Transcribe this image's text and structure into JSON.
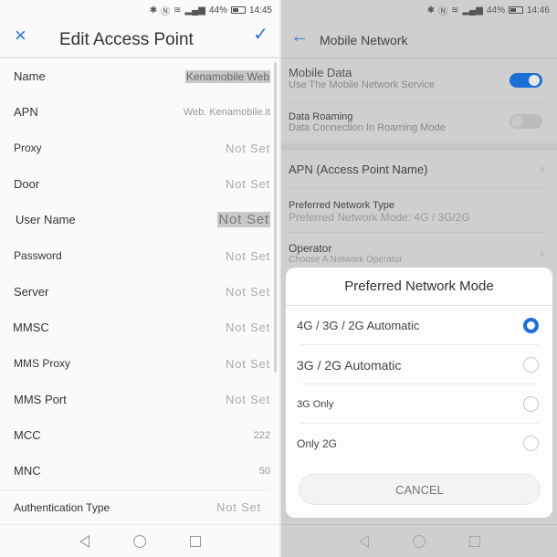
{
  "left": {
    "status": {
      "icons": [
        "bluetooth-icon",
        "nfc-icon",
        "wifi-icon",
        "signal-icon"
      ],
      "battery": "44%",
      "time": "14:45"
    },
    "header": {
      "title": "Edit Access Point",
      "close_icon": "×",
      "confirm_icon": "✓"
    },
    "fields": [
      {
        "label": "Name",
        "value": "Kenamobile Web"
      },
      {
        "label": "APN",
        "value": "Web. Kenamobile.it"
      },
      {
        "label": "Proxy",
        "value": "Not Set"
      },
      {
        "label": "Door",
        "value": "Not Set"
      },
      {
        "label": "User Name",
        "value": "Not Set"
      },
      {
        "label": "Password",
        "value": "Not Set"
      },
      {
        "label": "Server",
        "value": "Not Set"
      },
      {
        "label": "MMSC",
        "value": "Not Set"
      },
      {
        "label": "MMS Proxy",
        "value": "Not Set"
      },
      {
        "label": "MMS Port",
        "value": "Not Set"
      },
      {
        "label": "MCC",
        "value": "222"
      },
      {
        "label": "MNC",
        "value": "50"
      },
      {
        "label": "Authentication Type",
        "value": "Not Set"
      }
    ]
  },
  "right": {
    "status": {
      "icons": [
        "bluetooth-icon",
        "nfc-icon",
        "wifi-icon",
        "signal-icon"
      ],
      "battery": "44%",
      "time": "14:46"
    },
    "header": {
      "title": "Mobile Network",
      "back_icon": "←"
    },
    "settings": {
      "mobile_data": {
        "title": "Mobile Data",
        "subtitle": "Use The Mobile Network Service",
        "enabled": true
      },
      "data_roaming": {
        "title": "Data Roaming",
        "subtitle": "Data Connection In Roaming Mode",
        "enabled": false
      },
      "apn": {
        "title": "APN (Access Point Name)"
      },
      "network_type": {
        "title": "Preferred Network Type",
        "subtitle": "Preferred Network Mode: 4G / 3G/2G"
      },
      "operator": {
        "title": "Operator",
        "subtitle": "Choose A Network Operator"
      }
    },
    "dialog": {
      "title": "Preferred Network Mode",
      "options": [
        {
          "label": "4G / 3G / 2G Automatic",
          "selected": true
        },
        {
          "label": "3G / 2G Automatic",
          "selected": false
        },
        {
          "label": "3G Only",
          "selected": false
        },
        {
          "label": "Only 2G",
          "selected": false
        }
      ],
      "cancel_label": "CANCEL"
    }
  },
  "colors": {
    "accent": "#1a6fd6",
    "title_accent": "#2a76d6"
  }
}
